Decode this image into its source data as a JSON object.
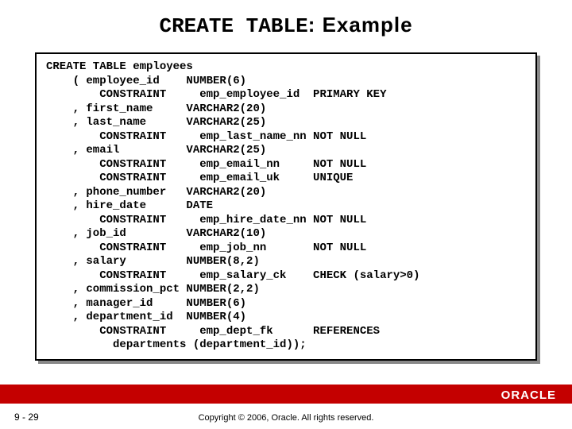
{
  "title_prefix": "CREATE TABLE",
  "title_suffix": ": Example",
  "code": "CREATE TABLE employees\n    ( employee_id    NUMBER(6)\n        CONSTRAINT     emp_employee_id  PRIMARY KEY\n    , first_name     VARCHAR2(20)\n    , last_name      VARCHAR2(25)\n        CONSTRAINT     emp_last_name_nn NOT NULL\n    , email          VARCHAR2(25)\n        CONSTRAINT     emp_email_nn     NOT NULL\n        CONSTRAINT     emp_email_uk     UNIQUE\n    , phone_number   VARCHAR2(20)\n    , hire_date      DATE\n        CONSTRAINT     emp_hire_date_nn NOT NULL\n    , job_id         VARCHAR2(10)\n        CONSTRAINT     emp_job_nn       NOT NULL\n    , salary         NUMBER(8,2)\n        CONSTRAINT     emp_salary_ck    CHECK (salary>0)\n    , commission_pct NUMBER(2,2)\n    , manager_id     NUMBER(6)\n    , department_id  NUMBER(4)\n        CONSTRAINT     emp_dept_fk      REFERENCES\n          departments (department_id));",
  "page_number": "9 - 29",
  "copyright": "Copyright © 2006, Oracle. All rights reserved.",
  "logo_text": "ORACLE"
}
